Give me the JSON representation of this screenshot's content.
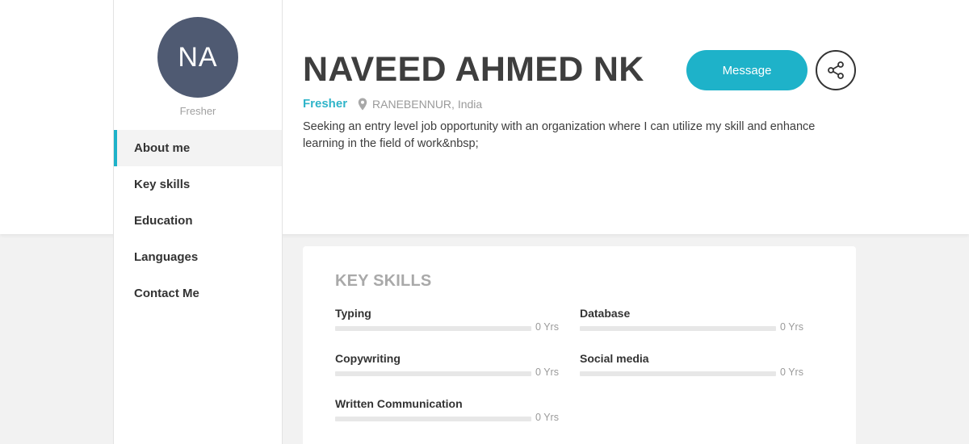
{
  "profile": {
    "initials": "NA",
    "side_status": "Fresher",
    "name": "NAVEED AHMED NK",
    "status": "Fresher",
    "location": "RANEBENNUR, India",
    "bio": "Seeking an entry level job opportunity with an organization where I can utilize my skill and enhance learning in the field of work&nbsp;"
  },
  "actions": {
    "message_label": "Message",
    "share_icon": "share-icon"
  },
  "sidebar": {
    "items": [
      {
        "label": "About me",
        "active": true
      },
      {
        "label": "Key skills",
        "active": false
      },
      {
        "label": "Education",
        "active": false
      },
      {
        "label": "Languages",
        "active": false
      },
      {
        "label": "Contact Me",
        "active": false
      }
    ]
  },
  "key_skills": {
    "title": "KEY SKILLS",
    "items": [
      {
        "name": "Typing",
        "years": "0 Yrs"
      },
      {
        "name": "Database",
        "years": "0 Yrs"
      },
      {
        "name": "Copywriting",
        "years": "0 Yrs"
      },
      {
        "name": "Social media",
        "years": "0 Yrs"
      },
      {
        "name": "Written Communication",
        "years": "0 Yrs"
      }
    ]
  },
  "colors": {
    "accent": "#1eb2c9",
    "avatar_bg": "#4f5a72"
  }
}
